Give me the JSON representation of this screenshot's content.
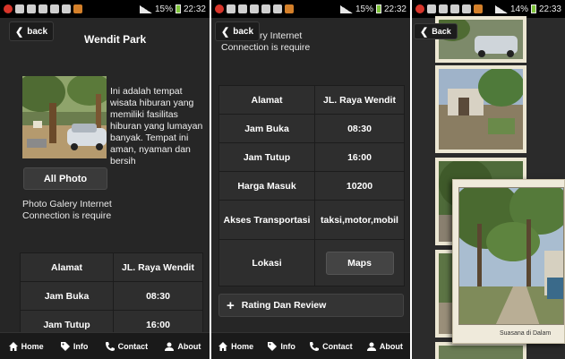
{
  "status_bar": {
    "screen1": {
      "battery": "15%",
      "time": "22:32"
    },
    "screen2": {
      "battery": "15%",
      "time": "22:32"
    },
    "screen3": {
      "battery": "14%",
      "time": "22:33"
    }
  },
  "screen1": {
    "back_label": "back",
    "title": "Wendit Park",
    "description": "Ini adalah tempat wisata hiburan yang memiliki fasilitas hiburan yang lumayan banyak. Tempat ini aman, nyaman dan bersih",
    "all_photo_label": "All Photo",
    "connection_msg": "Photo Galery Internet Connection is require",
    "table": [
      {
        "label": "Alamat",
        "value": "JL. Raya Wendit"
      },
      {
        "label": "Jam Buka",
        "value": "08:30"
      },
      {
        "label": "Jam Tutup",
        "value": "16:00"
      }
    ]
  },
  "screen2": {
    "back_label": "back",
    "connection_msg_line1": "alery Internet",
    "connection_msg_line2": "Connection is require",
    "table": [
      {
        "label": "Alamat",
        "value": "JL. Raya Wendit"
      },
      {
        "label": "Jam Buka",
        "value": "08:30"
      },
      {
        "label": "Jam Tutup",
        "value": "16:00"
      },
      {
        "label": "Harga Masuk",
        "value": "10200"
      },
      {
        "label": "Akses Transportasi",
        "value": "taksi,motor,mobil"
      },
      {
        "label": "Lokasi",
        "value": "Maps"
      }
    ],
    "rating_label": "Rating Dan Review"
  },
  "screen3": {
    "back_label": "Back",
    "popup_caption": "Suasana di Dalam"
  },
  "navbar": {
    "items": [
      {
        "label": "Home",
        "icon": "home-icon"
      },
      {
        "label": "Info",
        "icon": "tag-icon"
      },
      {
        "label": "Contact",
        "icon": "phone-icon"
      },
      {
        "label": "About",
        "icon": "person-icon"
      }
    ]
  }
}
